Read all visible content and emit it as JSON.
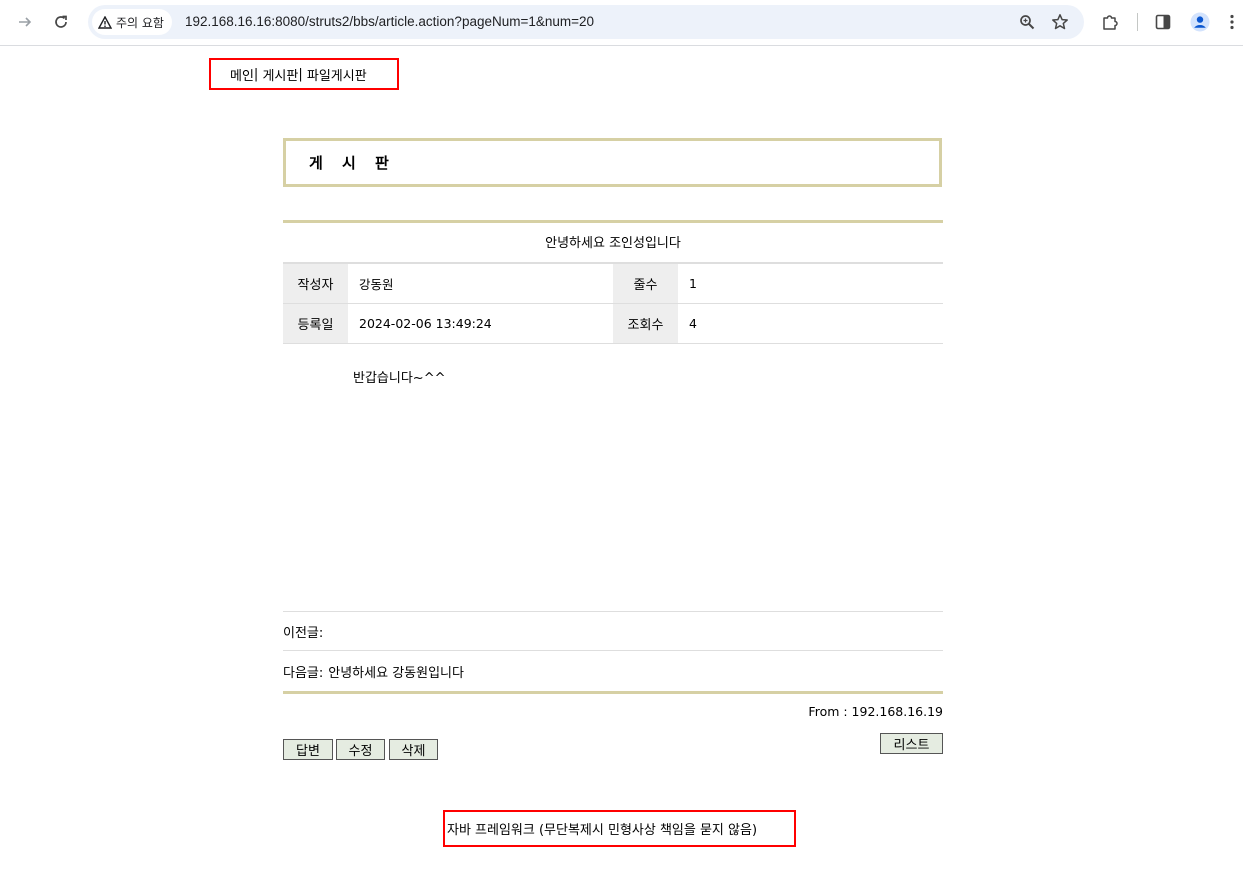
{
  "browser": {
    "security_label": "주의 요함",
    "url": "192.168.16.16:8080/struts2/bbs/article.action?pageNum=1&num=20"
  },
  "topnav": {
    "items": [
      "메인",
      "게시판",
      "파일게시판"
    ],
    "separator": "|"
  },
  "board": {
    "title": "게 시 판"
  },
  "article": {
    "subject": "안녕하세요 조인성입니다",
    "author_label": "작성자",
    "author": "강동원",
    "lines_label": "줄수",
    "lines": "1",
    "date_label": "등록일",
    "date": "2024-02-06 13:49:24",
    "hits_label": "조회수",
    "hits": "4",
    "content": "반갑습니다~^^",
    "prev_label": "이전글:",
    "prev_title": "",
    "next_label": "다음글:",
    "next_title": "안녕하세요 강동원입니다",
    "from_text": "From : 192.168.16.19"
  },
  "buttons": {
    "reply": "답변",
    "edit": "수정",
    "delete": "삭제",
    "list": "리스트"
  },
  "footer": {
    "text": "자바 프레임워크 (무단복제시 민형사상 책임을 묻지 않음)"
  }
}
